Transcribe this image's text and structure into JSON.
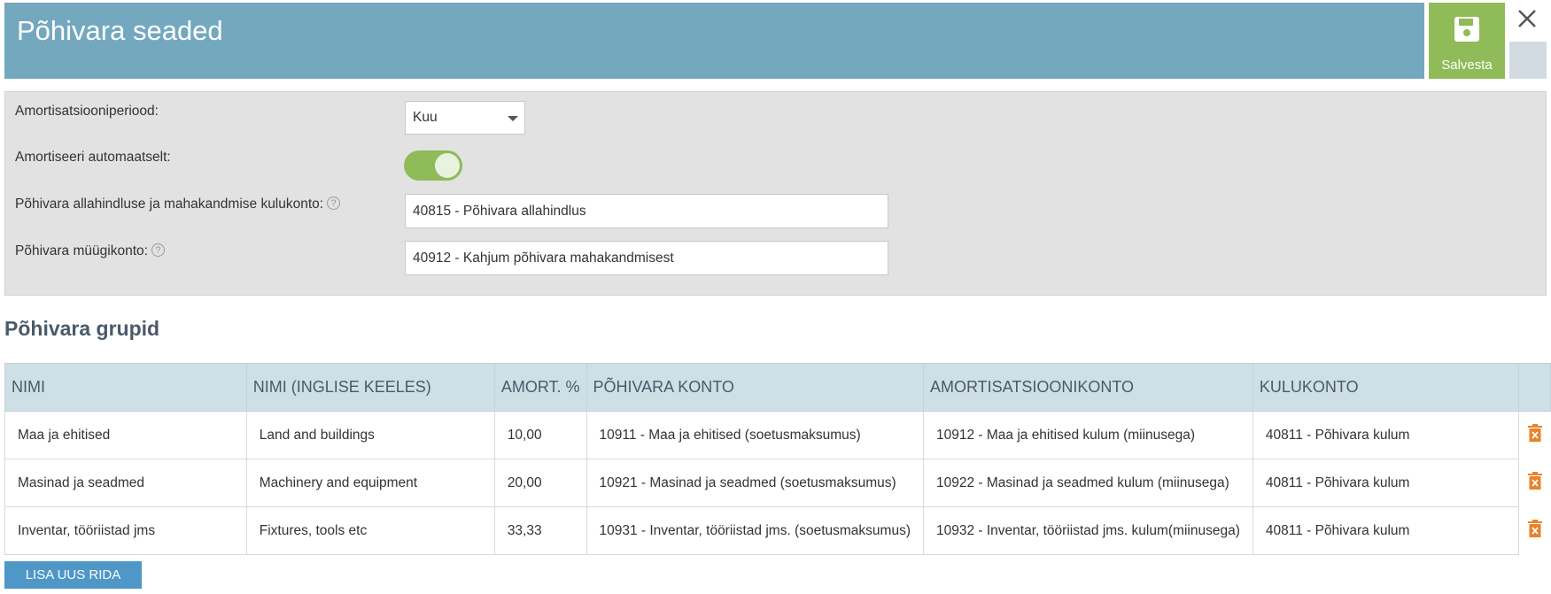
{
  "header": {
    "title": "Põhivara seaded",
    "save_label": "Salvesta"
  },
  "settings": {
    "period_label": "Amortisatsiooniperiood:",
    "period_value": "Kuu",
    "auto_label": "Amortiseeri automaatselt:",
    "auto_enabled": true,
    "expense_label": "Põhivara allahindluse ja mahakandmise kulukonto:",
    "expense_value": "40815 - Põhivara allahindlus",
    "sale_label": "Põhivara müügikonto:",
    "sale_value": "40912 - Kahjum põhivara mahakandmisest",
    "help_glyph": "?"
  },
  "groups": {
    "title": "Põhivara grupid",
    "columns": [
      "NIMI",
      "NIMI (INGLISE KEELES)",
      "AMORT. %",
      "PÕHIVARA KONTO",
      "AMORTISATSIOONIKONTO",
      "KULUKONTO"
    ],
    "rows": [
      [
        "Maa ja ehitised",
        "Land and buildings",
        "10,00",
        "10911 - Maa ja ehitised (soetusmaksumus)",
        "10912 - Maa ja ehitised kulum (miinusega)",
        "40811 - Põhivara kulum"
      ],
      [
        "Masinad ja seadmed",
        "Machinery and equipment",
        "20,00",
        "10921 - Masinad ja seadmed (soetusmaksumus)",
        "10922 - Masinad ja seadmed kulum (miinusega)",
        "40811 - Põhivara kulum"
      ],
      [
        "Inventar, tööriistad jms",
        "Fixtures, tools etc",
        "33,33",
        "10931 - Inventar, tööriistad jms. (soetusmaksumus)",
        "10932 - Inventar, tööriistad jms. kulum(miinusega)",
        "40811 - Põhivara kulum"
      ]
    ],
    "add_label": "LISA UUS RIDA"
  },
  "colors": {
    "header": "#74a8bf",
    "save": "#8fbb58",
    "toggle": "#8fbb58",
    "table_header": "#cfdfe6",
    "delete": "#e8832a",
    "add_button": "#4e97c7"
  },
  "icons": {
    "save": "floppy-disk-icon",
    "close": "close-icon",
    "delete": "trash-icon",
    "dropdown": "chevron-down-icon",
    "help": "help-icon"
  }
}
